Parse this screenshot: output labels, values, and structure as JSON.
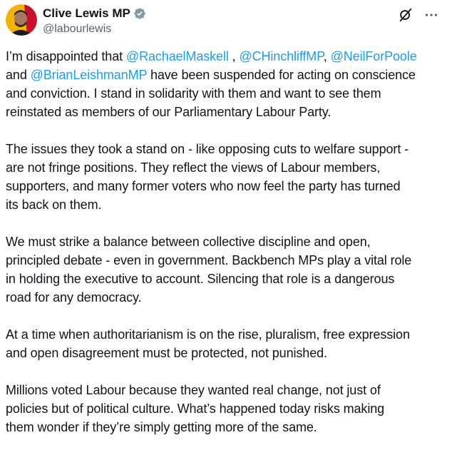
{
  "author": {
    "display_name": "Clive Lewis MP",
    "handle": "@labourlewis",
    "verified_icon": "verified-badge-icon",
    "avatar_colors": [
      "#f2b400",
      "#c8102e"
    ]
  },
  "actions": {
    "grok_icon": "grok-icon",
    "more_icon": "more-dots-icon"
  },
  "colors": {
    "mention": "#1d9bf0",
    "text": "#0f1419",
    "secondary": "#536471"
  },
  "body": {
    "p1": {
      "l1_a": "I’m disappointed that ",
      "m1": "@RachaelMaskell",
      "l1_b": " , ",
      "m2": "@CHinchliffMP",
      "l1_c": ", ",
      "m3": "@NeilForPoole",
      "l2_a": "and ",
      "m4": "@BrianLeishmanMP",
      "l2_b": " have been suspended for acting on conscience",
      "l3": "and conviction. I stand in solidarity with them and want to see them",
      "l4": "reinstated as members of our Parliamentary Labour Party."
    },
    "p2": {
      "l1": "The issues they took a stand on - like opposing cuts to welfare support -",
      "l2": "are not fringe positions. They reflect the views of Labour members,",
      "l3": "supporters, and many former voters who now feel the party has turned",
      "l4": "its back on them."
    },
    "p3": {
      "l1": "We must strike a balance between collective discipline and open,",
      "l2": "principled debate - even in government. Backbench MPs play a vital role",
      "l3": "in holding the executive to account. Silencing that role is a dangerous",
      "l4": "road for any democracy."
    },
    "p4": {
      "l1": "At a time when authoritarianism is on the rise, pluralism, free expression",
      "l2": "and open disagreement must be protected, not punished."
    },
    "p5": {
      "l1": "Millions voted Labour because they wanted real change, not just of",
      "l2": "policies but of political culture. What’s happened today risks making",
      "l3": "them wonder if they’re simply getting more of the same."
    }
  }
}
